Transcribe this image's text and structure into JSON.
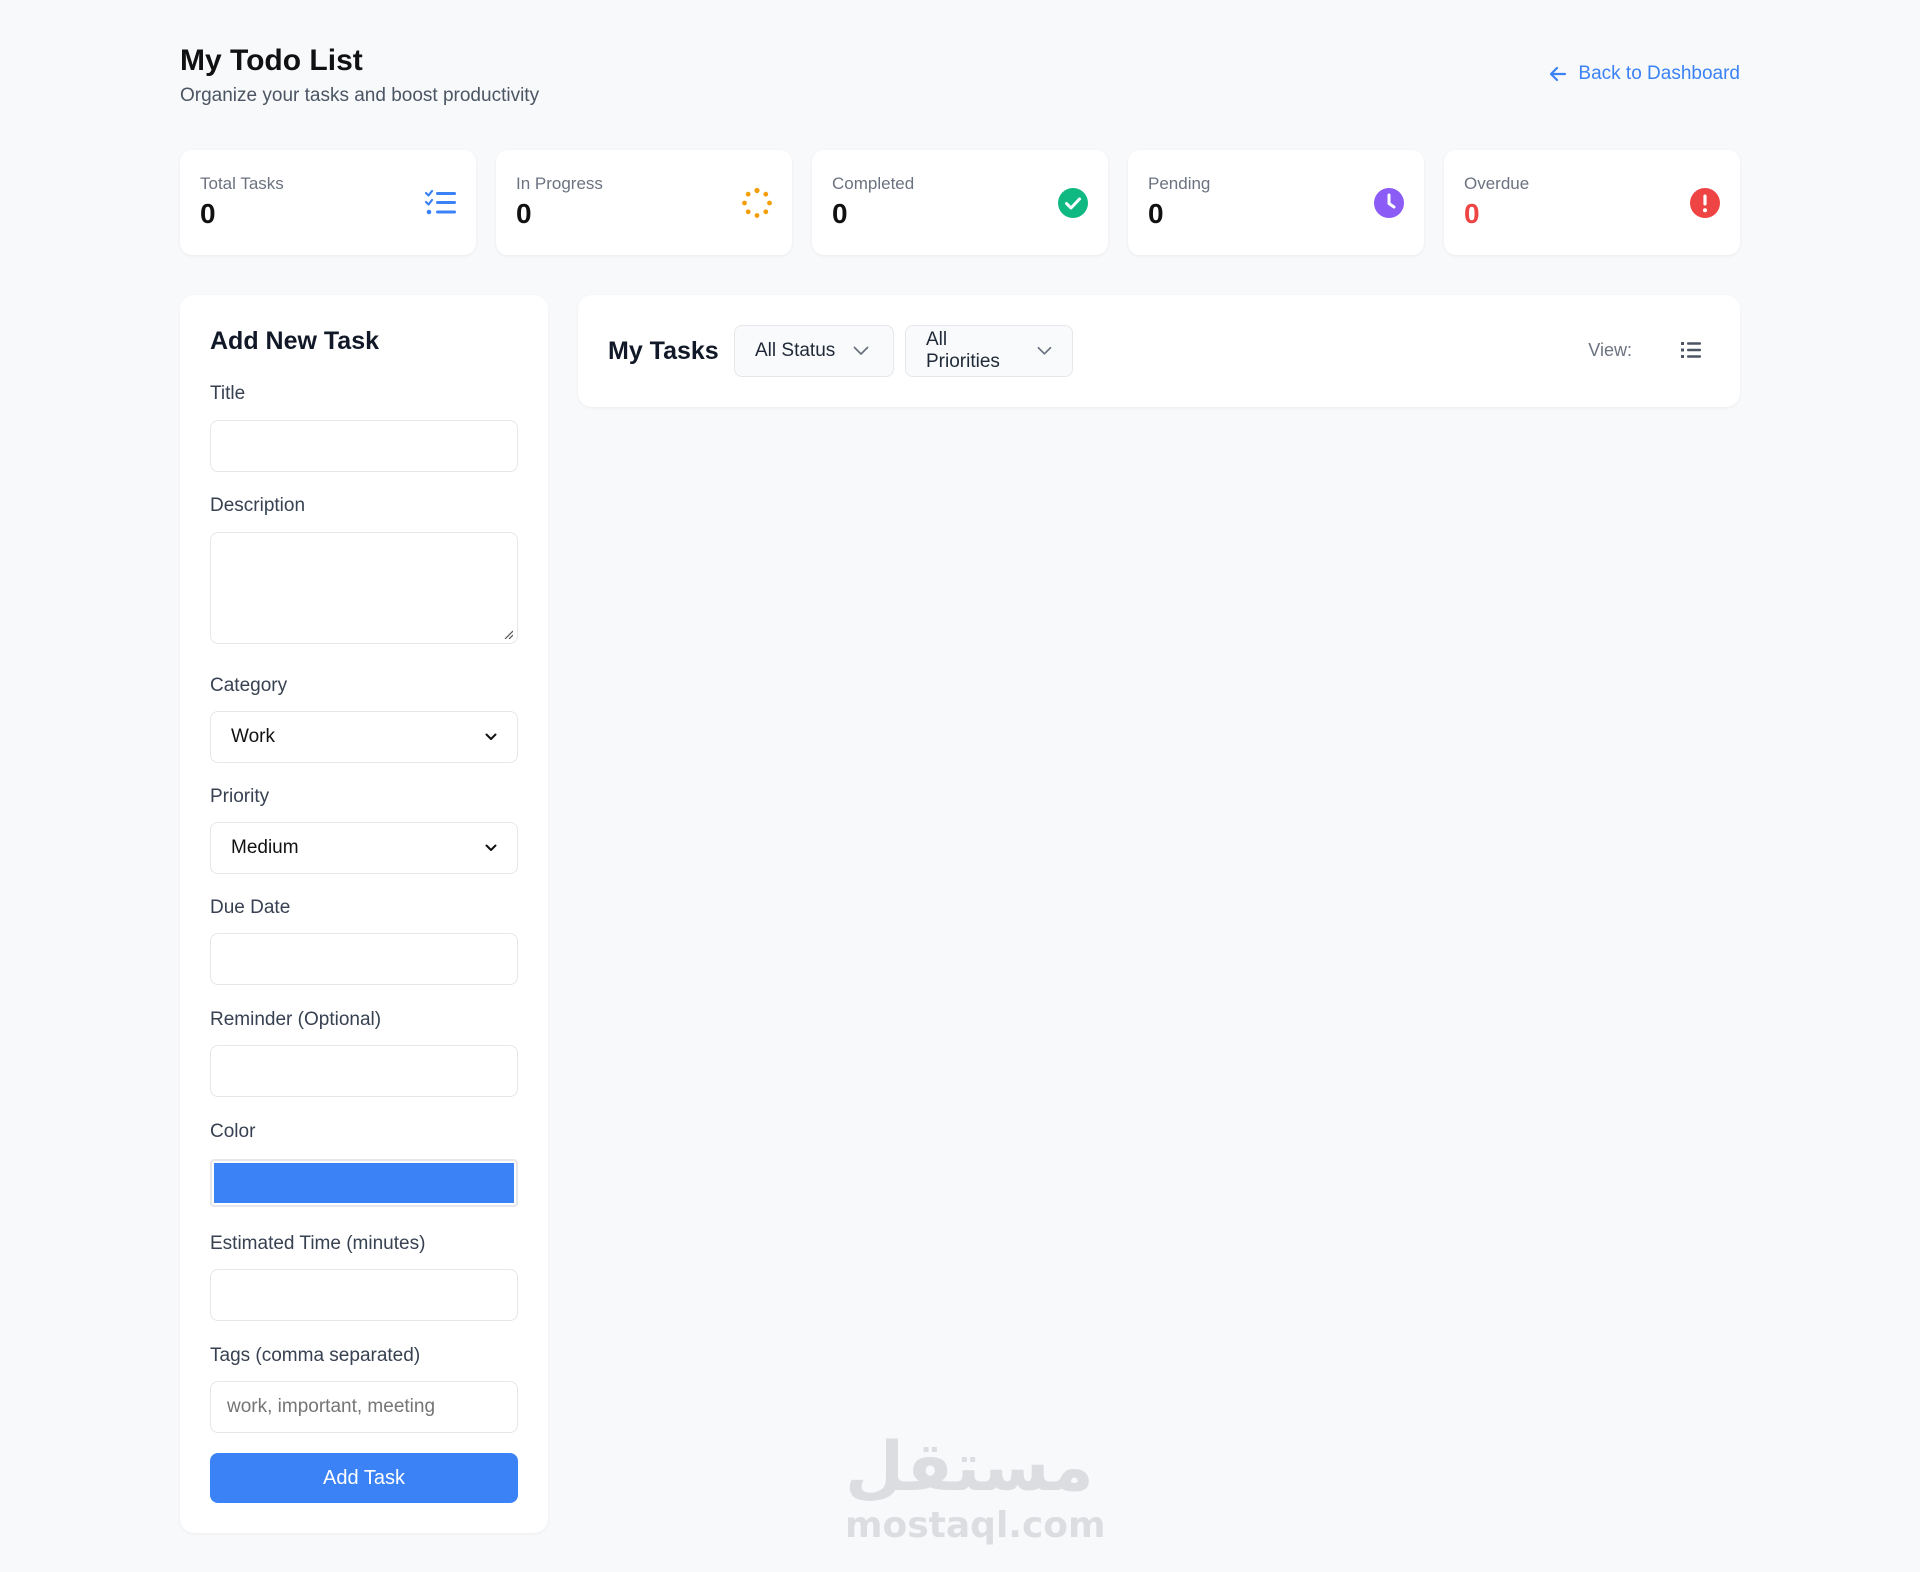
{
  "header": {
    "title": "My Todo List",
    "subtitle": "Organize your tasks and boost productivity",
    "back_link": "Back to Dashboard"
  },
  "stats": [
    {
      "label": "Total Tasks",
      "value": "0",
      "icon": "checklist-icon",
      "color": "#3b82f6"
    },
    {
      "label": "In Progress",
      "value": "0",
      "icon": "spinner-icon",
      "color": "#f59e0b"
    },
    {
      "label": "Completed",
      "value": "0",
      "icon": "check-circle-icon",
      "color": "#10b981"
    },
    {
      "label": "Pending",
      "value": "0",
      "icon": "clock-icon",
      "color": "#8b5cf6"
    },
    {
      "label": "Overdue",
      "value": "0",
      "icon": "exclamation-circle-icon",
      "color": "#ef4444"
    }
  ],
  "add_task": {
    "title": "Add New Task",
    "fields": {
      "title_label": "Title",
      "title_value": "",
      "description_label": "Description",
      "description_value": "",
      "category_label": "Category",
      "category_value": "Work",
      "priority_label": "Priority",
      "priority_value": "Medium",
      "due_date_label": "Due Date",
      "due_date_value": "",
      "reminder_label": "Reminder (Optional)",
      "reminder_value": "",
      "color_label": "Color",
      "color_value": "#3b82f6",
      "estimated_label": "Estimated Time (minutes)",
      "estimated_value": "",
      "tags_label": "Tags (comma separated)",
      "tags_placeholder": "work, important, meeting"
    },
    "submit_label": "Add Task"
  },
  "tasks": {
    "title": "My Tasks",
    "status_filter": "All Status",
    "priority_filter": "All Priorities",
    "view_label": "View:",
    "view_icon": "list-icon"
  },
  "watermark": {
    "arabic": "مستقل",
    "latin": "mostaql.com"
  }
}
